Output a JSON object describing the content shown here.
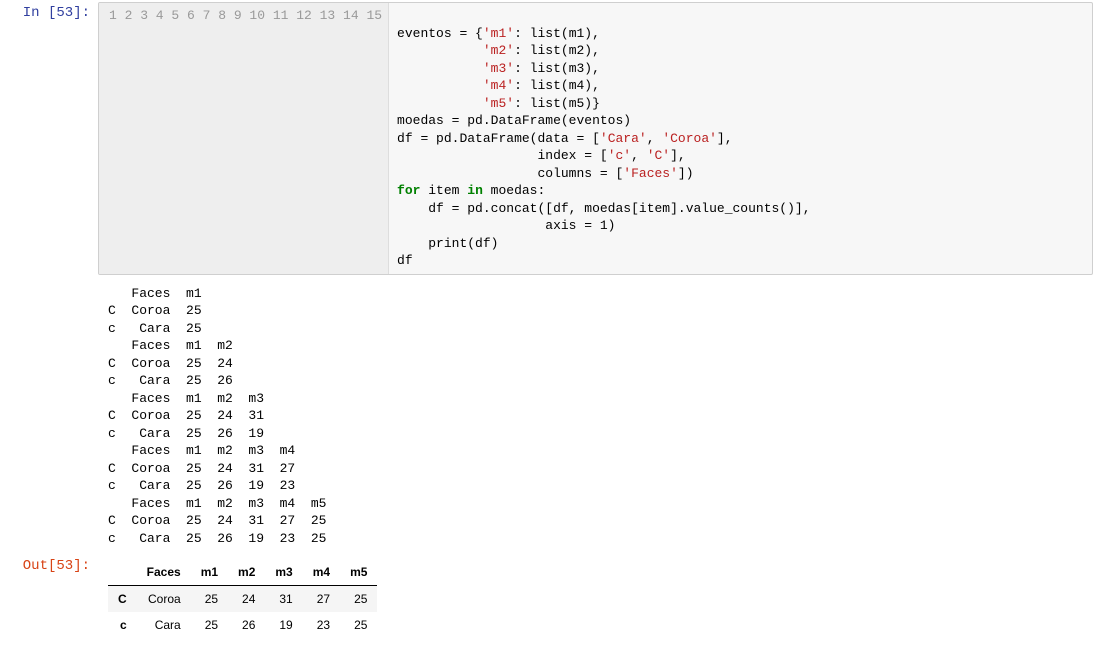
{
  "input": {
    "prompt": "In [53]:",
    "line_count": 15,
    "code": {
      "l1": "",
      "l2a": "eventos = {",
      "l2s": "'m1'",
      "l2b": ": list(m1),",
      "l3sp": "           ",
      "l3s": "'m2'",
      "l3b": ": list(m2),",
      "l4sp": "           ",
      "l4s": "'m3'",
      "l4b": ": list(m3),",
      "l5sp": "           ",
      "l5s": "'m4'",
      "l5b": ": list(m4),",
      "l6sp": "           ",
      "l6s": "'m5'",
      "l6b": ": list(m5)}",
      "l7": "moedas = pd.DataFrame(eventos)",
      "l8a": "df = pd.DataFrame(data = [",
      "l8s1": "'Cara'",
      "l8m": ", ",
      "l8s2": "'Coroa'",
      "l8b": "],",
      "l9sp": "                  index = [",
      "l9s1": "'c'",
      "l9m": ", ",
      "l9s2": "'C'",
      "l9b": "],",
      "l10sp": "                  columns = [",
      "l10s": "'Faces'",
      "l10b": "])",
      "l11a": "for",
      "l11b": " item ",
      "l11c": "in",
      "l11d": " moedas:",
      "l12": "    df = pd.concat([df, moedas[item].value_counts()],",
      "l13": "                   axis = 1)",
      "l14": "    print(df)",
      "l15": "df"
    }
  },
  "stdout": "   Faces  m1\nC  Coroa  25\nc   Cara  25\n   Faces  m1  m2\nC  Coroa  25  24\nc   Cara  25  26\n   Faces  m1  m2  m3\nC  Coroa  25  24  31\nc   Cara  25  26  19\n   Faces  m1  m2  m3  m4\nC  Coroa  25  24  31  27\nc   Cara  25  26  19  23\n   Faces  m1  m2  m3  m4  m5\nC  Coroa  25  24  31  27  25\nc   Cara  25  26  19  23  25",
  "output": {
    "prompt": "Out[53]:",
    "table": {
      "columns": [
        "",
        "Faces",
        "m1",
        "m2",
        "m3",
        "m4",
        "m5"
      ],
      "rows": [
        {
          "idx": "C",
          "cells": [
            "Coroa",
            "25",
            "24",
            "31",
            "27",
            "25"
          ]
        },
        {
          "idx": "c",
          "cells": [
            "Cara",
            "25",
            "26",
            "19",
            "23",
            "25"
          ]
        }
      ]
    }
  }
}
